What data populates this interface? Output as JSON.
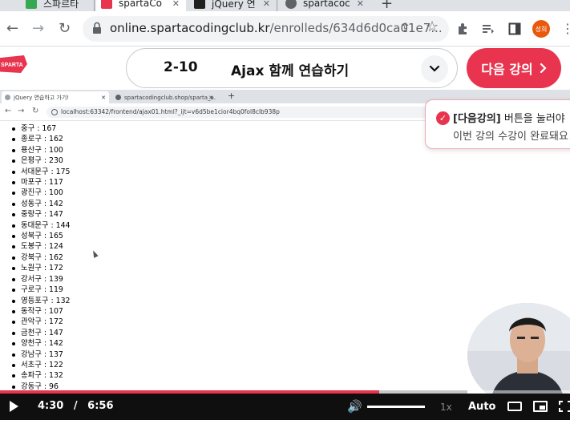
{
  "browser": {
    "tabs": [
      {
        "title": "스파르타",
        "active": false,
        "color": "#34a853"
      },
      {
        "title": "spartaCo",
        "active": true,
        "color": "#e8344e"
      },
      {
        "title": "jQuery 연",
        "active": false,
        "color": "#1f1f1f"
      },
      {
        "title": "spartacoc",
        "active": false,
        "color": "#5f6368"
      }
    ],
    "new_tab": "+",
    "url_host": "online.spartacodingclub.kr",
    "url_path": "/enrolleds/634d6d0ca01e7...",
    "profile_label": "성희"
  },
  "lesson": {
    "logo_text": "SPARTA",
    "number": "2-10",
    "title": "Ajax 함께 연습하기",
    "next_label": "다음 강의",
    "brand_color": "#e8344e"
  },
  "inner_browser": {
    "tabs": [
      {
        "title": "jQuery 연습하고 가기!",
        "active": true
      },
      {
        "title": "spartacodingclub.shop/sparta_a...",
        "active": false
      }
    ],
    "url": "localhost:63342/frontend/ajax01.html?_ijt=v6d5be1cior4bq0fol8clb938p",
    "items": [
      "중구 : 167",
      "종로구 : 162",
      "용산구 : 100",
      "은평구 : 230",
      "서대문구 : 175",
      "마포구 : 117",
      "광진구 : 100",
      "성동구 : 142",
      "중랑구 : 147",
      "동대문구 : 144",
      "성북구 : 165",
      "도봉구 : 124",
      "강북구 : 162",
      "노원구 : 172",
      "강서구 : 139",
      "구로구 : 119",
      "영등포구 : 132",
      "동작구 : 107",
      "관악구 : 172",
      "금천구 : 147",
      "양천구 : 142",
      "강남구 : 137",
      "서초구 : 122",
      "송파구 : 132",
      "강동구 : 96"
    ]
  },
  "toast": {
    "label_bold": "[다음강의]",
    "line1_rest": " 버튼을 눌러야",
    "line2": "이번 강의 수강이 완료돼요"
  },
  "player": {
    "current_time": "4:30",
    "separator": "/",
    "duration": "6:56",
    "played_fraction": 0.665,
    "buffered_fraction": 0.82,
    "speed": "1x",
    "quality": "Auto"
  }
}
